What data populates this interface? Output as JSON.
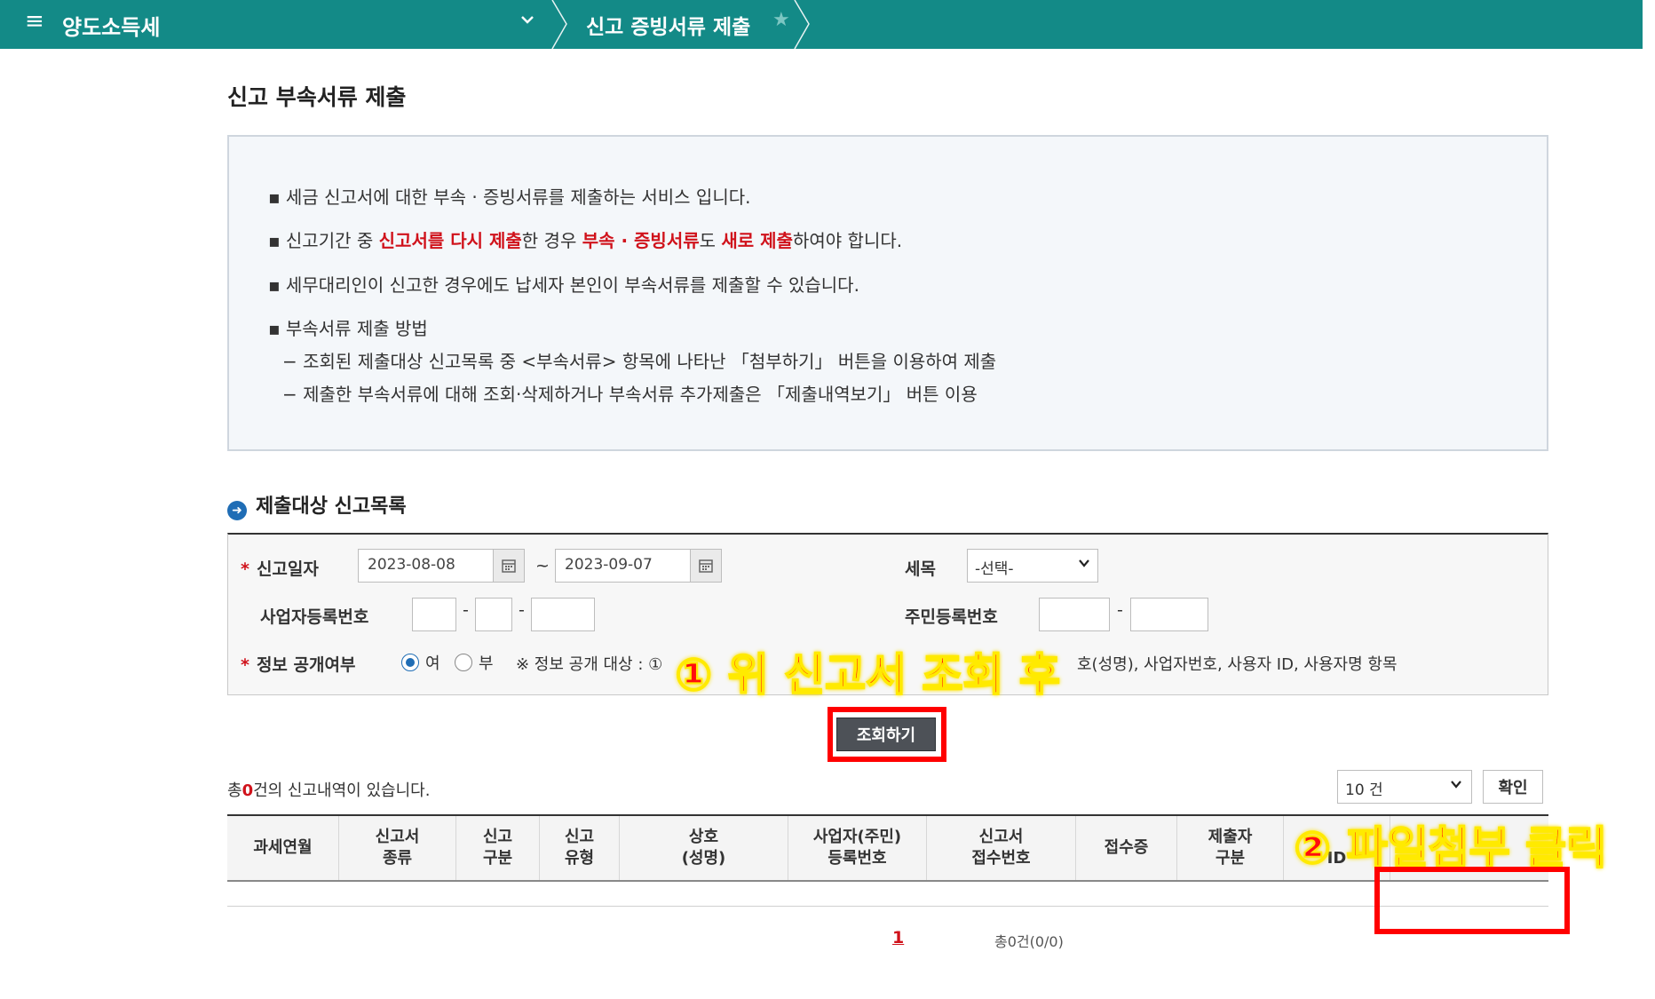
{
  "topbar": {
    "tax_name": "양도소득세",
    "page_name": "신고 증빙서류 제출",
    "accent": "#138a87"
  },
  "page_title": "신고 부속서류 제출",
  "info": {
    "line1": "▪ 세금 신고서에 대한 부속 · 증빙서류를 제출하는 서비스 입니다.",
    "line2_a": "▪ 신고기간 중 ",
    "line2_b": "신고서를 다시 제출",
    "line2_c": "한 경우 ",
    "line2_d": "부속 · 증빙서류",
    "line2_e": "도 ",
    "line2_f": "새로 제출",
    "line2_g": "하여야 합니다.",
    "line3": "▪ 세무대리인이 신고한 경우에도 납세자 본인이 부속서류를 제출할 수 있습니다.",
    "line4": "▪ 부속서류 제출 방법",
    "line5": "− 조회된 제출대상 신고목록 중 <부속서류> 항목에 나타난 「첨부하기」 버튼을 이용하여 제출",
    "line6": "− 제출한 부속서류에 대해 조회·삭제하거나 부속서류 추가제출은 「제출내역보기」 버튼 이용"
  },
  "section_title": "제출대상 신고목록",
  "search": {
    "required_mark": "*",
    "date_label": "신고일자",
    "date_from": "2023-08-08",
    "date_to": "2023-09-07",
    "tilde": "~",
    "tax_label": "세목",
    "tax_selected": "-선택-",
    "biz_label": "사업자등록번호",
    "resident_label": "주민등록번호",
    "dash": "-",
    "disclose_label": "정보 공개여부",
    "yes": "여",
    "no": "부",
    "notice_a": "※ 정보 공개 대상 : ①",
    "notice_b": "호(성명), 사업자번호, 사용자 ID, 사용자명 항목",
    "search_button": "조회하기"
  },
  "annotations": {
    "step1": "① 위 신고서 조회 후",
    "step2": "② 파일첨부 클릭"
  },
  "result": {
    "count_a": "총",
    "count_num": "0",
    "count_b": "건의 신고내역이 있습니다.",
    "page_size": "10 건",
    "confirm": "확인"
  },
  "table": {
    "columns": [
      "과세연월",
      "신고서\n종류",
      "신고\n구분",
      "신고\n유형",
      "상호\n(성명)",
      "사업자(주민)\n등록번호",
      "신고서\n접수번호",
      "접수증",
      "제출자\n구분",
      "ID"
    ]
  },
  "pager": {
    "current": "1",
    "total": "총0건(0/0)"
  }
}
